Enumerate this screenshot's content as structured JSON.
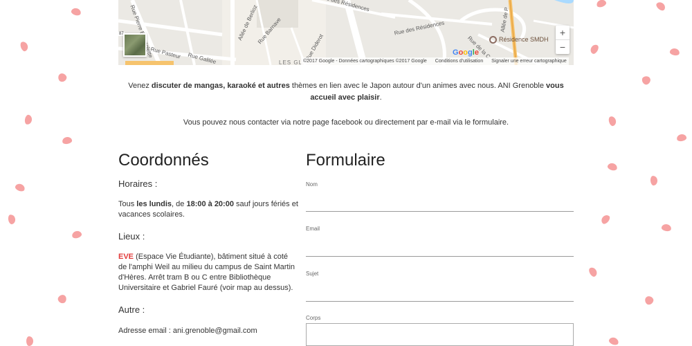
{
  "map": {
    "labels": {
      "road1": "Rue Pierre Brossolette",
      "road2": "Rue Pasteur",
      "road3": "Rue Galilée",
      "road4": "Allée de Berlioz",
      "road5": "Rue Barnave",
      "road6": "Rue Diderot",
      "road7": "Rue des Résidences",
      "road8": "Rue des Résidences",
      "area": "LES GL",
      "road9": "Rue de la C",
      "road10": "Allée de P"
    },
    "poi": "Résidence SMDH",
    "google": [
      "G",
      "o",
      "o",
      "g",
      "l",
      "e"
    ],
    "attribution": {
      "copyright": "©2017 Google - Données cartographiques ©2017 Google",
      "terms": "Conditions d'utilisation",
      "report": "Signaler une erreur cartographique"
    },
    "zoom_in": "+",
    "zoom_out": "−"
  },
  "intro": {
    "part1": "Venez ",
    "bold1": "discuter de mangas, karaoké et autres",
    "part2": " thèmes en lien avec le Japon autour d'un animes avec nous. ANI Grenoble ",
    "bold2": "vous accueil avec plaisir",
    "part3": "."
  },
  "contact_line": "Vous pouvez nous contacter via notre page facebook ou directement par e-mail via le formulaire.",
  "coords": {
    "title": "Coordonnés",
    "hours_title": "Horaires :",
    "hours": {
      "p1": "Tous ",
      "b1": "les lundis",
      "p2": ", de ",
      "b2": "18:00 à 20:00",
      "p3": " sauf jours fériés et vacances scolaires."
    },
    "places_title": "Lieux :",
    "places": {
      "eve": "EVE",
      "text": " (Espace Vie Étudiante), bâtiment situé à coté de l'amphi Weil au milieu du campus de Saint Martin d'Hères. Arrêt tram B ou C entre Bibliothèque Universitaire et Gabriel Fauré (voir map au dessus)."
    },
    "other_title": "Autre :",
    "email": "Adresse email : ani.grenoble@gmail.com"
  },
  "form": {
    "title": "Formulaire",
    "name_label": "Nom",
    "email_label": "Email",
    "subject_label": "Sujet",
    "body_label": "Corps"
  }
}
